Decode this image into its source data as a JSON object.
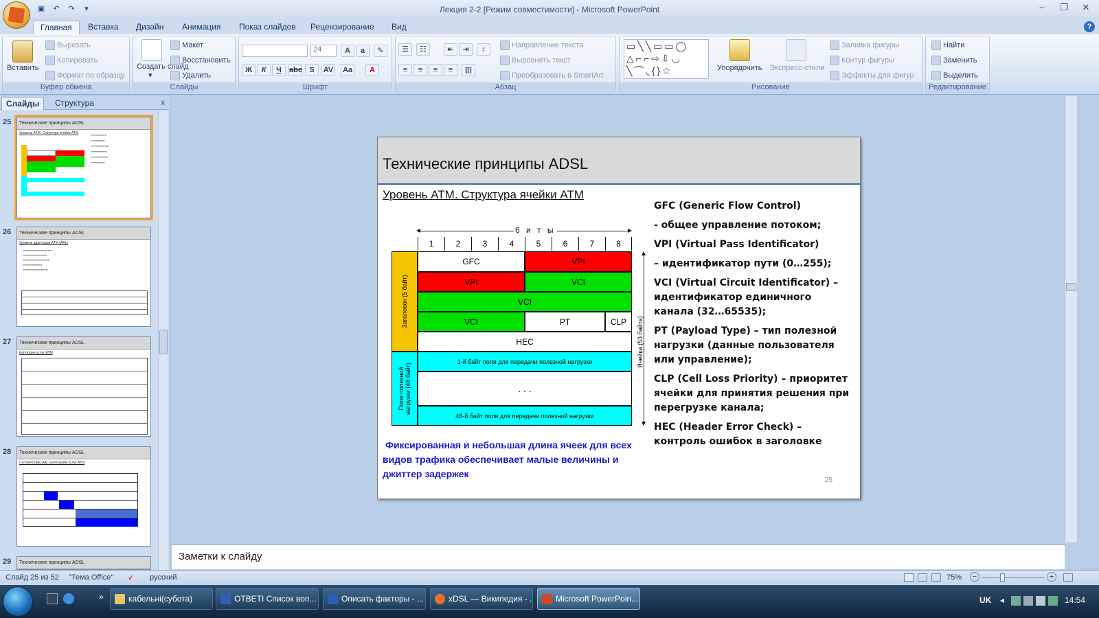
{
  "window": {
    "title": "Лекция 2-2 [Режим совместимости] - Microsoft PowerPoint",
    "controls": [
      "–",
      "❐",
      "✕"
    ]
  },
  "tabs": [
    "Главная",
    "Вставка",
    "Дизайн",
    "Анимация",
    "Показ слайдов",
    "Рецензирование",
    "Вид"
  ],
  "ribbon": {
    "clipboard": {
      "label": "Буфер обмена",
      "paste": "Вставить",
      "cut": "Вырезать",
      "copy": "Копировать",
      "format": "Формат по образцу"
    },
    "slides": {
      "label": "Слайды",
      "new_slide": "Создать слайд",
      "new_slide_arrow": "▾",
      "layout": "Макет",
      "reset": "Восстановить",
      "delete": "Удалить"
    },
    "font": {
      "label": "Шрифт",
      "size": "24"
    },
    "paragraph": {
      "label": "Абзац",
      "direction": "Направление текста",
      "align": "Выровнять текст",
      "smartart": "Преобразовать в SmartArt"
    },
    "drawing": {
      "label": "Рисование",
      "arrange": "Упорядочить",
      "styles": "Экспресс-стили",
      "fill": "Заливка фигуры",
      "outline": "Контур фигуры",
      "effects": "Эффекты для фигур"
    },
    "editing": {
      "label": "Редактирование",
      "find": "Найти",
      "replace": "Заменить",
      "select": "Выделить"
    }
  },
  "panel": {
    "tab_slides": "Слайды",
    "tab_outline": "Структура",
    "close": "x",
    "thumbs": [
      {
        "num": "25",
        "title": "Технические принципы ADSL",
        "sub": "Уровень ATM. Структура ячейки ATM"
      },
      {
        "num": "26",
        "title": "Технические принципы ADSL",
        "sub": "Уровень адаптации ATM (AAL)"
      },
      {
        "num": "27",
        "title": "Технические принципы ADSL",
        "sub": "Категории услуг ATM"
      },
      {
        "num": "28",
        "title": "Технические принципы ADSL",
        "sub": "Соответствие AAL категориям услуг ATM"
      },
      {
        "num": "29",
        "title": "Технические принципы ADSL",
        "sub": ""
      }
    ]
  },
  "slide": {
    "title": "Технические принципы ADSL",
    "subtitle": "Уровень ATM. Структура ячейки ATM",
    "bits_label": "6 и т ы",
    "bit_numbers": [
      "1",
      "2",
      "3",
      "4",
      "5",
      "6",
      "7",
      "8"
    ],
    "header_side_label": "Заголовок (5 байт)",
    "payload_side_label": "Поле полезной нагрузки (48 байт)",
    "cell_side_label": "Ячейка (53 байта)",
    "cells": {
      "gfc": "GFC",
      "vpi1": "VPI",
      "vpi2": "VPI",
      "vci1": "VCI",
      "vci2": "VCI",
      "vci3": "VCI",
      "pt": "PT",
      "clp": "CLP",
      "hec": "HEC",
      "payload_first": "1-й байт поля для передачи полезной нагрузки",
      "payload_dots": ". . .",
      "payload_last": "48-й байт поля для передачи полезной нагрузки"
    },
    "note": "Фиксированная и небольшая длина ячеек для всех видов трафика обеспечивает малые величины и джиттер задержек",
    "definitions": [
      "GFC (Generic Flow Control)",
      "- общее управление потоком;",
      "VPI (Virtual Pass Identificator)",
      "– идентификатор пути (0…255);",
      "VCI (Virtual Circuit Identificator) – идентификатор единичного канала (32…65535);",
      "PT (Payload Type) – тип полезной нагрузки (данные пользователя или управление);",
      "CLP (Cell Loss Priority) – приоритет ячейки для принятия решения при перегрузке канала;",
      "HEC (Header Error Check) – контроль ошибок в заголовке"
    ],
    "number": "25"
  },
  "notes_placeholder": "Заметки к слайду",
  "status": {
    "slide_pos": "Слайд 25 из 52",
    "theme": "\"Тема Office\"",
    "language": "русский",
    "zoom": "75%"
  },
  "taskbar": {
    "items": [
      "кабельні(субота)",
      "ОТВЕТІ Список воп...",
      "Описать факторы - ...",
      "xDSL — Википедия - ...",
      "Microsoft PowerPoin..."
    ],
    "lang": "UK",
    "time": "14:54"
  },
  "colors": {
    "header_fill": "#f5c400",
    "red": "#ff0000",
    "green": "#00e100",
    "cyan": "#00ffff",
    "note_text": "#1a1ac8"
  }
}
